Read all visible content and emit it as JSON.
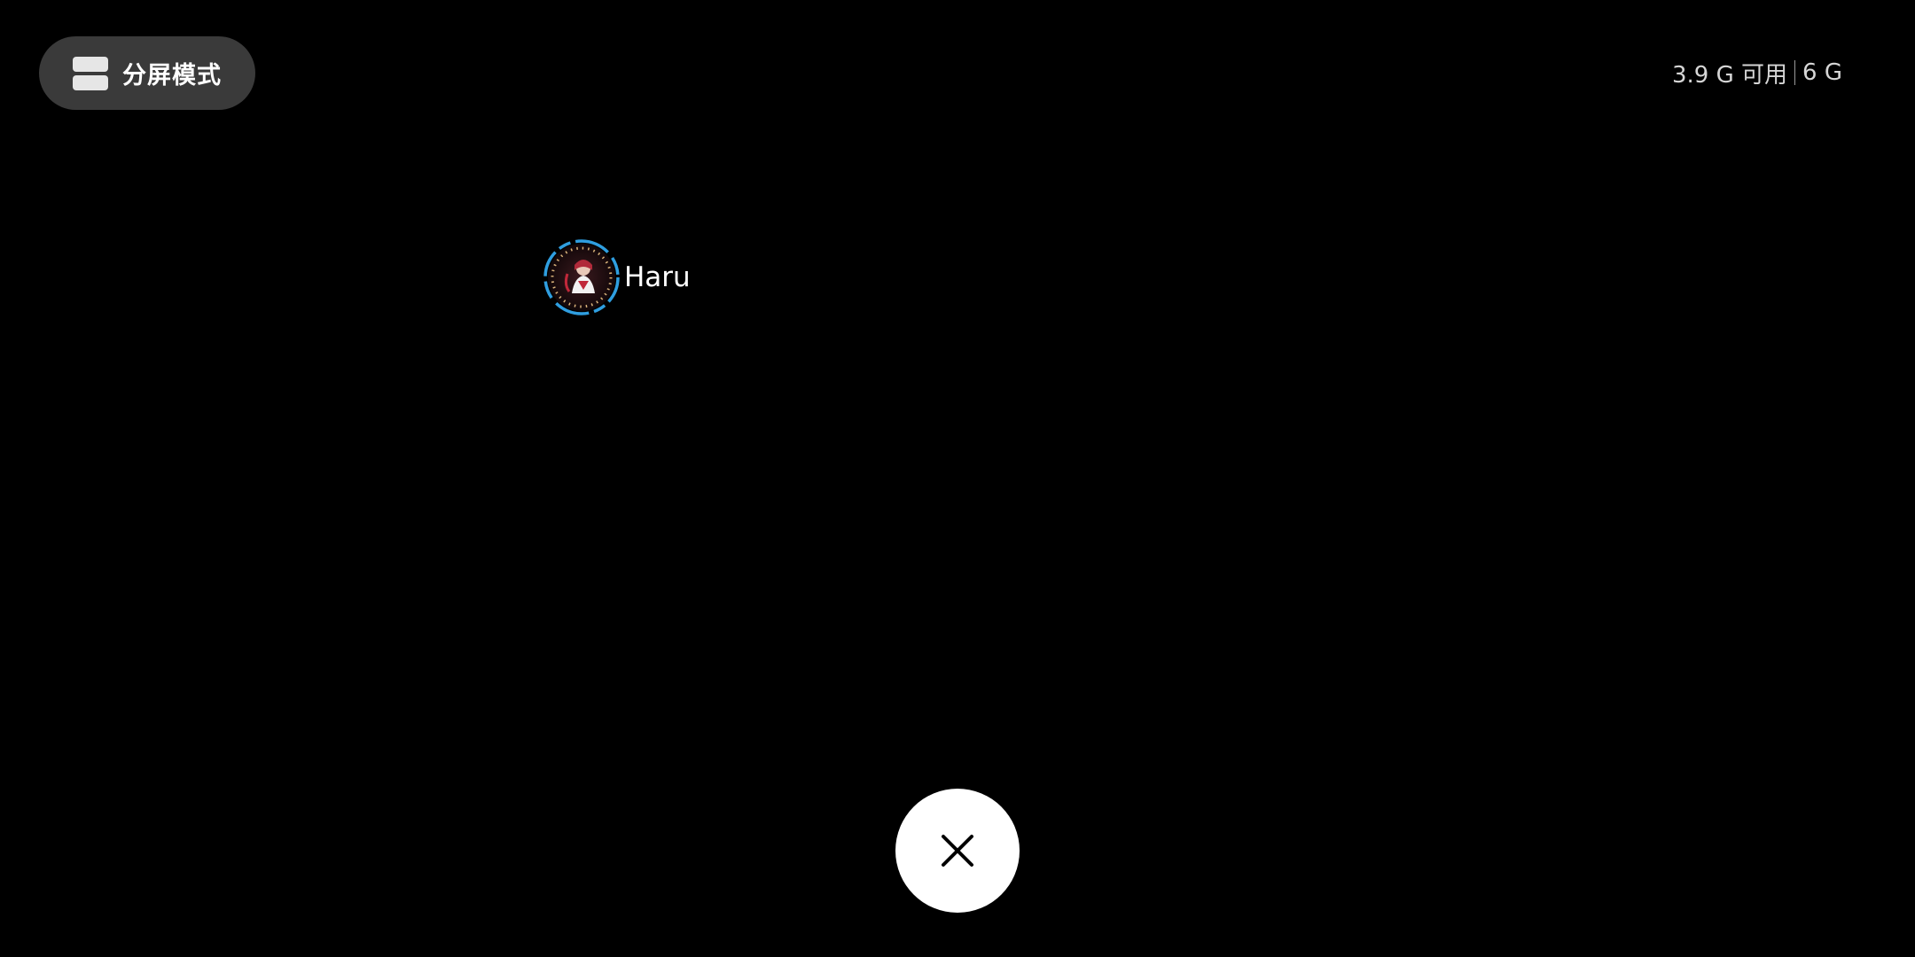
{
  "split_screen": {
    "label": "分屏模式",
    "icon": "split-screen-icon"
  },
  "memory": {
    "available": "3.9 G 可用",
    "total": "6 G"
  },
  "recent_apps": [
    {
      "name": "Haru",
      "icon": "haru-app-icon"
    }
  ],
  "close_all": {
    "icon": "close-icon"
  },
  "colors": {
    "background": "#000000",
    "pill": "#3a3a3a",
    "close_button": "#ffffff",
    "icon_ring": "#2f9ee0"
  }
}
